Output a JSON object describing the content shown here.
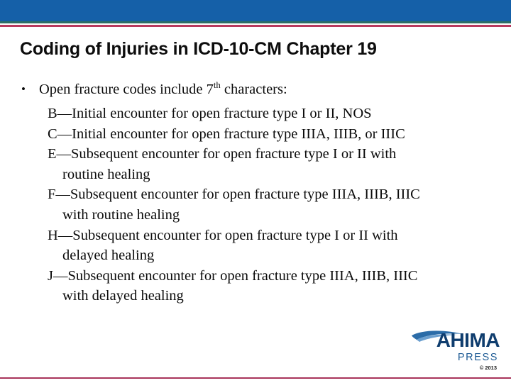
{
  "slide": {
    "title": "Coding of Injuries in ICD-10-CM Chapter 19",
    "header": {
      "band_color": "#1560a8",
      "teal_rule_color": "#2c6e66",
      "crimson_rule_color": "#b93a5e"
    },
    "footer": {
      "crimson_rule_color": "#a8335a"
    }
  },
  "body": {
    "bullet_glyph": "•",
    "lead_text_before": "Open fracture codes include 7",
    "lead_superscript": "th",
    "lead_text_after": " characters:",
    "items": [
      {
        "line1": "B—Initial encounter for open fracture type I or II, NOS",
        "line2": ""
      },
      {
        "line1": "C—Initial encounter for open fracture type IIIA, IIIB, or IIIC",
        "line2": ""
      },
      {
        "line1": "E—Subsequent encounter for open fracture type I or II with",
        "line2": "routine healing"
      },
      {
        "line1": "F—Subsequent encounter for open fracture type IIIA, IIIB, IIIC",
        "line2": "with routine healing"
      },
      {
        "line1": "H—Subsequent encounter for open fracture type I or II with",
        "line2": "delayed healing"
      },
      {
        "line1": "J—Subsequent encounter for open fracture type IIIA, IIIB, IIIC",
        "line2": "with delayed healing"
      }
    ]
  },
  "logo": {
    "wordmark": "AHIMA",
    "press_label": "PRESS",
    "copyright": "© 2013",
    "wordmark_color": "#0f3d6e",
    "swoosh_color": "#2b6ca8"
  }
}
